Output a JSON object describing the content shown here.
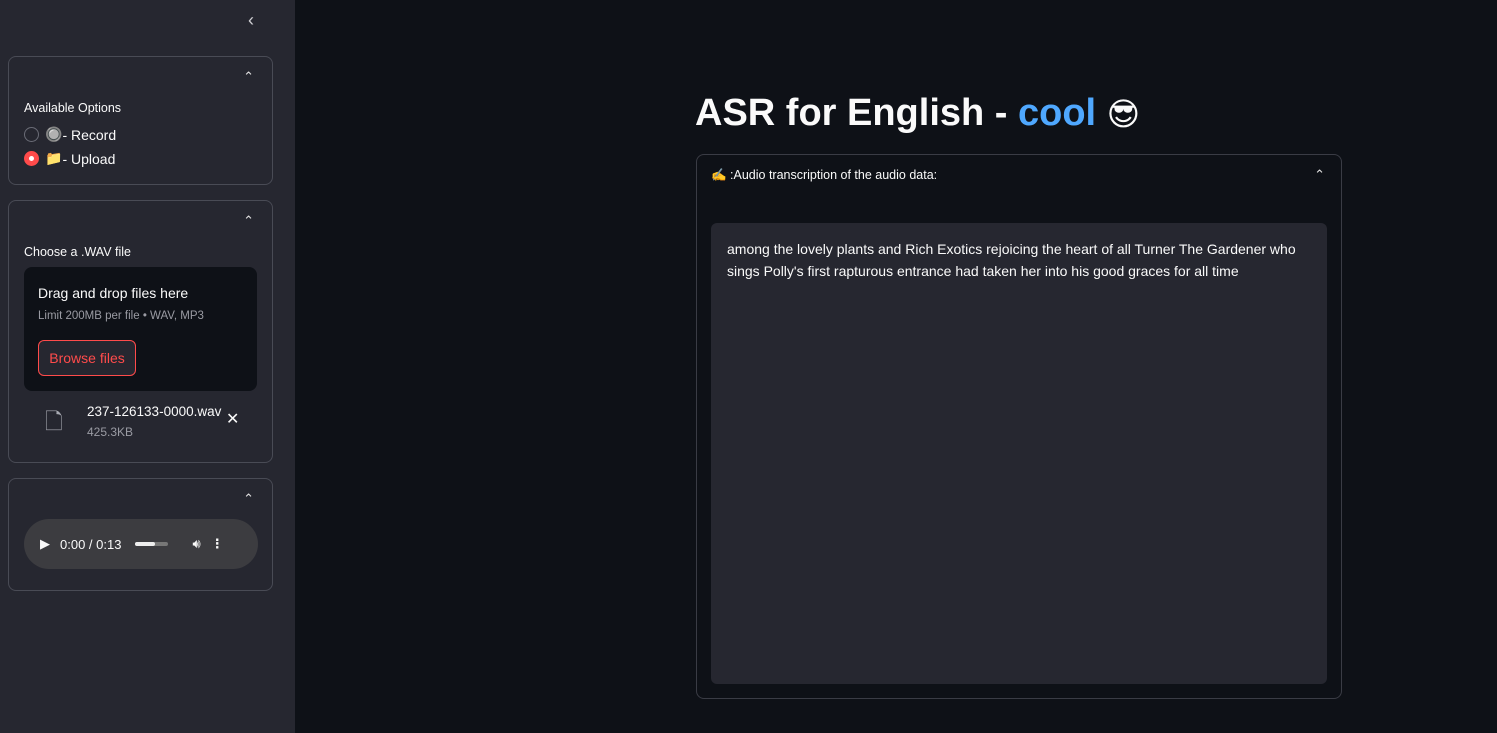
{
  "sidebar": {
    "options": {
      "label": "Available Options",
      "items": [
        {
          "icon": "🔘",
          "label": " - Record",
          "selected": false
        },
        {
          "icon": "📁",
          "label": " - Upload",
          "selected": true
        }
      ]
    },
    "uploader": {
      "label": "Choose a .WAV file",
      "drop_title": "Drag and drop files here",
      "limit": "Limit 200MB per file • WAV, MP3",
      "browse": "Browse files",
      "file_name": "237-126133-0000.wav",
      "file_size": "425.3KB"
    },
    "player": {
      "time": "0:00 / 0:13",
      "volume": 0.6
    }
  },
  "main": {
    "title": "ASR for English - ",
    "title_accent": "cool",
    "title_emoji": "😎",
    "accent_color": "#4fa8ff",
    "expander_label": "✍️ :Audio transcription of the audio data:",
    "transcription": "among the lovely plants and Rich Exotics rejoicing the heart of all Turner The Gardener who sings Polly's first rapturous entrance had taken her into his good graces for all time"
  }
}
